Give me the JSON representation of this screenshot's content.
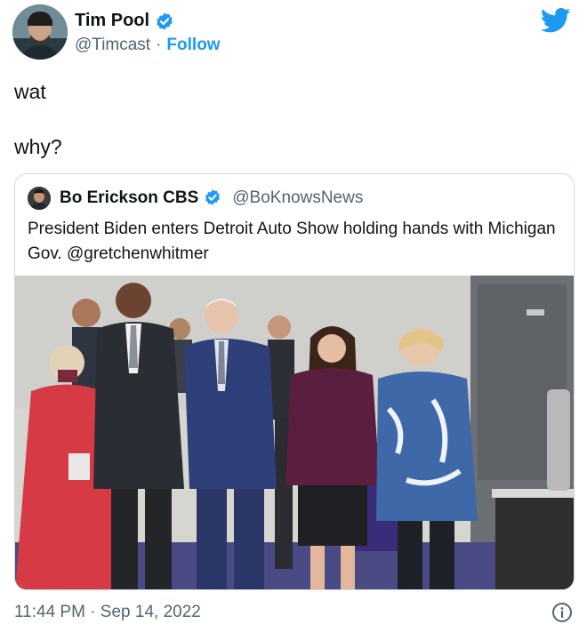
{
  "author": {
    "display_name": "Tim Pool",
    "handle": "@Timcast",
    "separator": "·",
    "follow_label": "Follow",
    "verified": true
  },
  "tweet": {
    "lines": [
      "wat",
      "why?"
    ]
  },
  "quoted_tweet": {
    "display_name": "Bo Erickson CBS",
    "handle": "@BoKnowsNews",
    "verified": true,
    "text": "President Biden enters Detroit Auto Show holding hands with Michigan Gov. @gretchenwhitmer"
  },
  "footer": {
    "timestamp": "11:44 PM · Sep 14, 2022"
  },
  "icons": {
    "platform": "twitter-bird-icon",
    "verified": "verified-badge-icon",
    "info": "info-icon"
  },
  "colors": {
    "accent": "#1d9bf0",
    "text": "#0f1419",
    "secondary_text": "#536471",
    "border": "#cfd9de"
  }
}
